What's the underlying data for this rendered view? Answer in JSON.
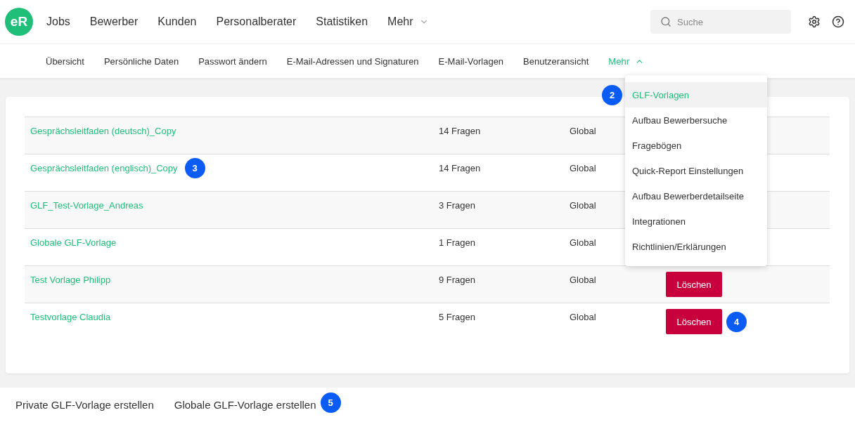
{
  "app": {
    "logo": "eR"
  },
  "main_nav": [
    {
      "label": "Jobs"
    },
    {
      "label": "Bewerber"
    },
    {
      "label": "Kunden"
    },
    {
      "label": "Personalberater"
    },
    {
      "label": "Statistiken"
    },
    {
      "label": "Mehr",
      "kind": "dropdown"
    }
  ],
  "search": {
    "placeholder": "Suche"
  },
  "sub_nav": [
    {
      "label": "Übersicht",
      "selected": false
    },
    {
      "label": "Persönliche Daten",
      "selected": false
    },
    {
      "label": "Passwort ändern",
      "selected": false
    },
    {
      "label": "E-Mail-Adressen und Signaturen",
      "selected": false
    },
    {
      "label": "E-Mail-Vorlagen",
      "selected": false
    },
    {
      "label": "Benutzeransicht",
      "selected": false
    },
    {
      "label": "Mehr",
      "selected": true,
      "kind": "dropdown",
      "expanded": true
    }
  ],
  "dropdown_menu": [
    {
      "label": "GLF-Vorlagen",
      "selected": true,
      "marker": "2"
    },
    {
      "label": "Aufbau Bewerbersuche",
      "selected": false
    },
    {
      "label": "Fragebögen",
      "selected": false
    },
    {
      "label": "Quick-Report Einstellungen",
      "selected": false
    },
    {
      "label": "Aufbau Bewerberdetailseite",
      "selected": false
    },
    {
      "label": "Integrationen",
      "selected": false
    },
    {
      "label": "Richtlinien/Erklärungen",
      "selected": false
    }
  ],
  "table": {
    "rows": [
      {
        "name": "Gesprächsleitfaden (deutsch)_Copy",
        "questions": "14 Fragen",
        "scope": "Global"
      },
      {
        "name": "Gesprächsleitfaden (englisch)_Copy",
        "questions": "14 Fragen",
        "scope": "Global",
        "marker": "3"
      },
      {
        "name": "GLF_Test-Vorlage_Andreas",
        "questions": "3 Fragen",
        "scope": "Global"
      },
      {
        "name": "Globale GLF-Vorlage",
        "questions": "1 Fragen",
        "scope": "Global"
      },
      {
        "name": "Test Vorlage Philipp",
        "questions": "9 Fragen",
        "scope": "Global",
        "delete_label": "Löschen"
      },
      {
        "name": "Testvorlage Claudia",
        "questions": "5 Fragen",
        "scope": "Global",
        "delete_label": "Löschen",
        "action_marker": "4"
      }
    ]
  },
  "footer_actions": [
    {
      "label": "Private GLF-Vorlage erstellen"
    },
    {
      "label": "Globale GLF-Vorlage erstellen",
      "marker": "5"
    }
  ]
}
